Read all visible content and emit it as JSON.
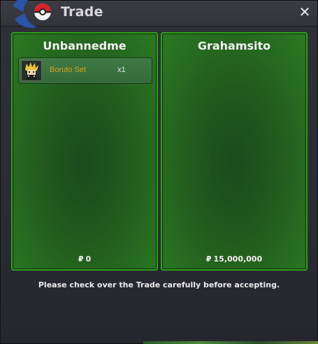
{
  "window": {
    "title": "Trade",
    "close_icon": "close-icon"
  },
  "trade": {
    "left": {
      "name": "Unbannedme",
      "items": [
        {
          "icon": "boruto-set-icon",
          "name": "Boruto Set",
          "qty": "x1"
        }
      ],
      "currency_symbol": "₽",
      "money": "0"
    },
    "right": {
      "name": "Grahamsito",
      "items": [],
      "currency_symbol": "₽",
      "money": "15,000,000"
    }
  },
  "notice": "Please check over the Trade carefully before accepting.",
  "colors": {
    "panel_border": "#2fa21c",
    "panel_fill": "#21591e",
    "item_name": "#d7a41c"
  }
}
